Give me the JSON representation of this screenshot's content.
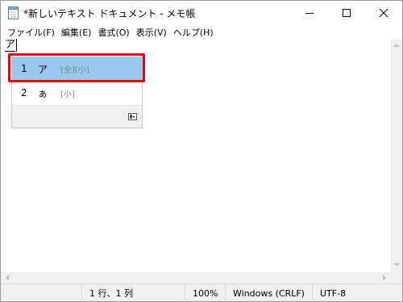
{
  "window": {
    "title": "*新しいテキスト ドキュメント - メモ帳"
  },
  "menu": [
    "ファイル(F)",
    "編集(E)",
    "書式(O)",
    "表示(V)",
    "ヘルプ(H)"
  ],
  "editor": {
    "typed_text": "ア"
  },
  "ime": {
    "candidates": [
      {
        "index": "1",
        "text": "ア",
        "info": "[全][小]"
      },
      {
        "index": "2",
        "text": "ぁ",
        "info": "[小]"
      }
    ],
    "expand_icon": "expand-icon"
  },
  "statusbar": {
    "position": "1 行、1 列",
    "zoom": "100%",
    "line_ending": "Windows (CRLF)",
    "encoding": "UTF-8"
  },
  "colors": {
    "selection": "#99c8ef",
    "highlight_box": "#e60012",
    "chrome": "#f0f0f0"
  }
}
